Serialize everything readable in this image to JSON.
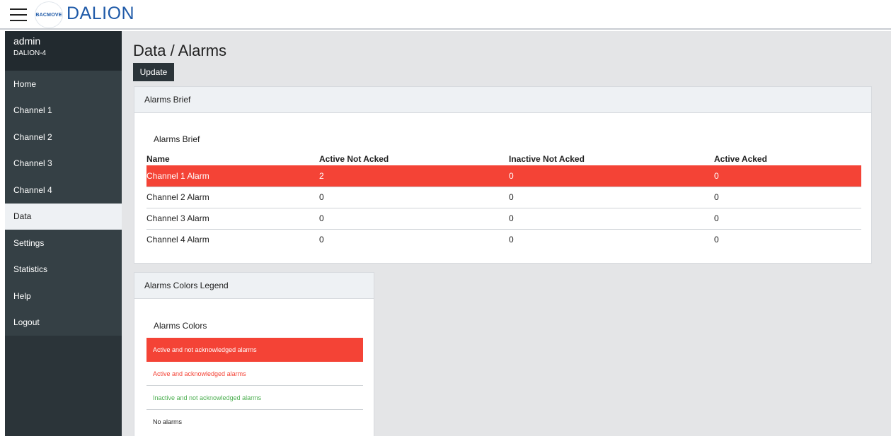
{
  "header": {
    "logo_text": "BACMOVE",
    "brand": "DALION"
  },
  "sidebar": {
    "user": "admin",
    "device": "DALION-4",
    "items": [
      {
        "label": "Home"
      },
      {
        "label": "Channel 1"
      },
      {
        "label": "Channel 2"
      },
      {
        "label": "Channel 3"
      },
      {
        "label": "Channel 4"
      },
      {
        "label": "Data"
      },
      {
        "label": "Settings"
      },
      {
        "label": "Statistics"
      },
      {
        "label": "Help"
      },
      {
        "label": "Logout"
      }
    ],
    "active_item": "Data"
  },
  "main": {
    "title": "Data / Alarms",
    "update_label": "Update"
  },
  "brief": {
    "header": "Alarms Brief",
    "title": "Alarms Brief",
    "columns": [
      "Name",
      "Active Not Acked",
      "Inactive Not Acked",
      "Active Acked"
    ],
    "rows": [
      {
        "name": "Channel 1 Alarm",
        "active_not_acked": "2",
        "inactive_not_acked": "0",
        "active_acked": "0",
        "state": "active-not-acked"
      },
      {
        "name": "Channel 2 Alarm",
        "active_not_acked": "0",
        "inactive_not_acked": "0",
        "active_acked": "0",
        "state": "none"
      },
      {
        "name": "Channel 3 Alarm",
        "active_not_acked": "0",
        "inactive_not_acked": "0",
        "active_acked": "0",
        "state": "none"
      },
      {
        "name": "Channel 4 Alarm",
        "active_not_acked": "0",
        "inactive_not_acked": "0",
        "active_acked": "0",
        "state": "none"
      }
    ]
  },
  "legend": {
    "header": "Alarms Colors Legend",
    "title": "Alarms Colors",
    "items": [
      {
        "label": "Active and not acknowledged alarms"
      },
      {
        "label": "Active and acknowledged alarms"
      },
      {
        "label": "Inactive and not acknowledged alarms"
      },
      {
        "label": "No alarms"
      }
    ]
  },
  "colors": {
    "sidebar": "#2b3439",
    "sidebar_user": "#222a2f",
    "active_not_acked": "#f44336",
    "inactive_not_acked": "#4caf50",
    "brand": "#1f5aa8",
    "main_bg": "#e4e5e7"
  }
}
